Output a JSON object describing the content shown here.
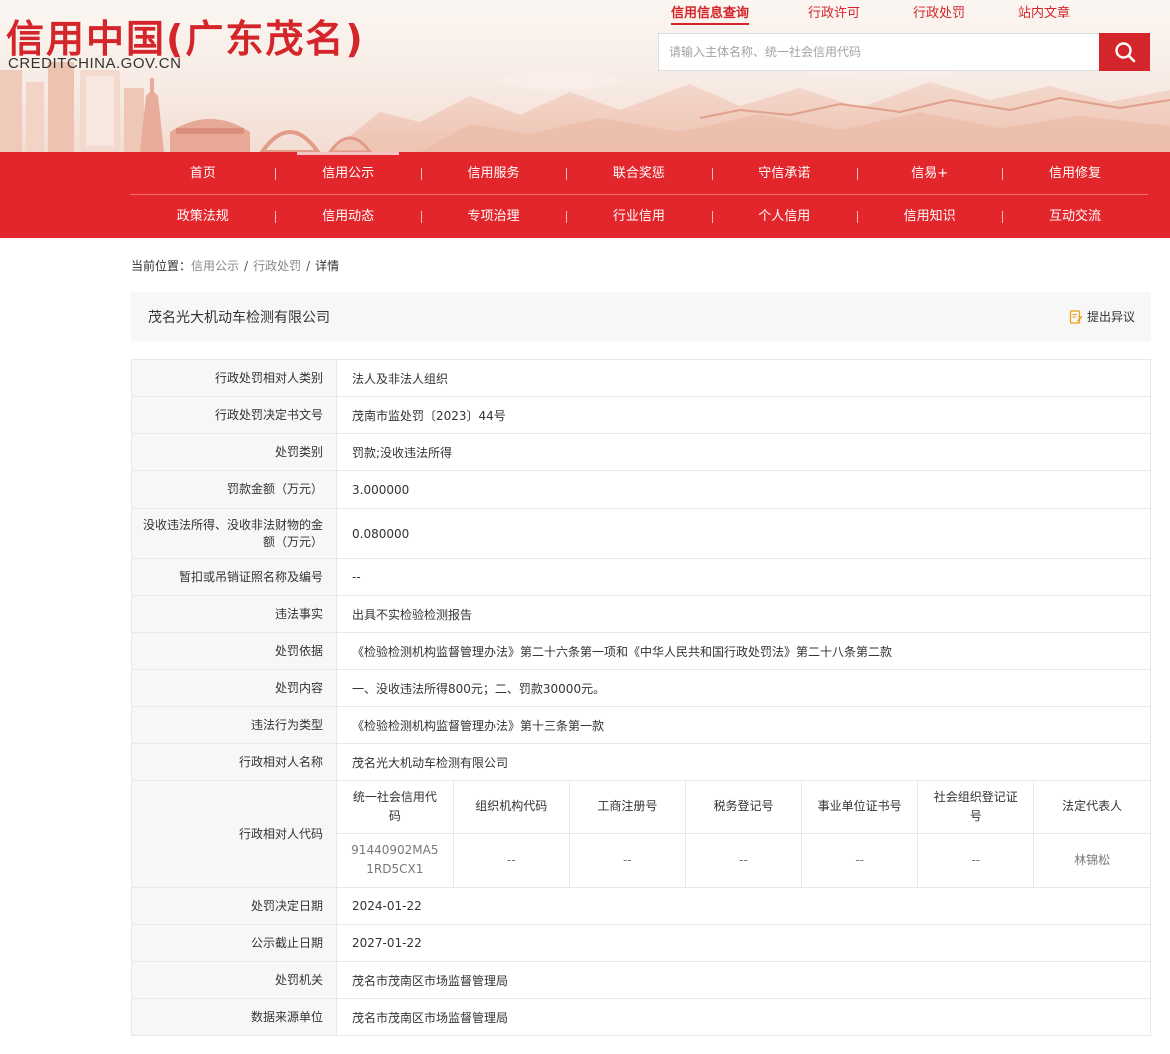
{
  "header": {
    "logo_cn": "信用中国(广东茂名)",
    "logo_en": "CREDITCHINA.GOV.CN",
    "top_links": [
      "信用信息查询",
      "行政许可",
      "行政处罚",
      "站内文章"
    ],
    "search_placeholder": "请输入主体名称、统一社会信用代码",
    "brand_color": "#d4252a"
  },
  "nav": {
    "row1": [
      "首页",
      "信用公示",
      "信用服务",
      "联合奖惩",
      "守信承诺",
      "信易+",
      "信用修复"
    ],
    "row2": [
      "政策法规",
      "信用动态",
      "专项治理",
      "行业信用",
      "个人信用",
      "信用知识",
      "互动交流"
    ]
  },
  "breadcrumb": {
    "label": "当前位置：",
    "items": [
      "信用公示",
      "行政处罚",
      "详情"
    ]
  },
  "page": {
    "title": "茂名光大机动车检测有限公司",
    "objection_label": "提出异议"
  },
  "rows_top": [
    {
      "label": "行政处罚相对人类别",
      "value": "法人及非法人组织"
    },
    {
      "label": "行政处罚决定书文号",
      "value": "茂南市监处罚〔2023〕44号"
    },
    {
      "label": "处罚类别",
      "value": "罚款;没收违法所得"
    },
    {
      "label": "罚款金额（万元）",
      "value": "3.000000"
    },
    {
      "label": "没收违法所得、没收非法财物的金额（万元）",
      "value": "0.080000"
    },
    {
      "label": "暂扣或吊销证照名称及编号",
      "value": "--"
    },
    {
      "label": "违法事实",
      "value": "出具不实检验检测报告"
    },
    {
      "label": "处罚依据",
      "value": "《检验检测机构监督管理办法》第二十六条第一项和《中华人民共和国行政处罚法》第二十八条第二款"
    },
    {
      "label": "处罚内容",
      "value": "一、没收违法所得800元；二、罚款30000元。"
    },
    {
      "label": "违法行为类型",
      "value": "《检验检测机构监督管理办法》第十三条第一款"
    },
    {
      "label": "行政相对人名称",
      "value": "茂名光大机动车检测有限公司"
    }
  ],
  "code_row": {
    "label": "行政相对人代码",
    "headers": [
      "统一社会信用代码",
      "组织机构代码",
      "工商注册号",
      "税务登记号",
      "事业单位证书号",
      "社会组织登记证号",
      "法定代表人"
    ],
    "values": [
      "91440902MA51RD5CX1",
      "--",
      "--",
      "--",
      "--",
      "--",
      "林锦松"
    ]
  },
  "rows_bottom": [
    {
      "label": "处罚决定日期",
      "value": "2024-01-22"
    },
    {
      "label": "公示截止日期",
      "value": "2027-01-22"
    },
    {
      "label": "处罚机关",
      "value": "茂名市茂南区市场监督管理局"
    },
    {
      "label": "数据来源单位",
      "value": "茂名市茂南区市场监督管理局"
    }
  ]
}
